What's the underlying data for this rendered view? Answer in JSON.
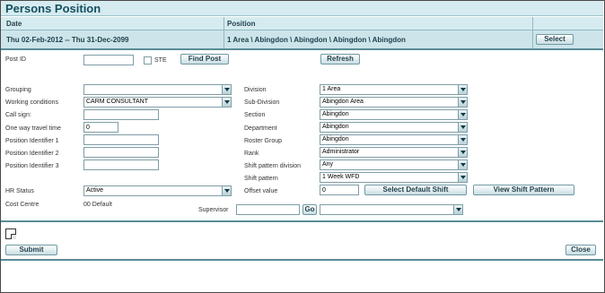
{
  "title": "Persons Position",
  "header": {
    "date_col": "Date",
    "position_col": "Position",
    "date_value": "Thu 02-Feb-2012 -- Thu 31-Dec-2099",
    "position_value": "1 Area \\ Abingdon \\ Abingdon \\ Abingdon \\ Abingdon",
    "select_label": "Select"
  },
  "post": {
    "post_id_label": "Post ID",
    "post_id_value": "",
    "ste_label": "STE",
    "find_post_label": "Find Post",
    "refresh_label": "Refresh"
  },
  "left": {
    "grouping_label": "Grouping",
    "grouping_value": "",
    "working_conditions_label": "Working conditions",
    "working_conditions_value": "CARM CONSULTANT",
    "call_sign_label": "Call sign:",
    "call_sign_value": "",
    "travel_label": "One way travel time",
    "travel_value": "0",
    "pos_id1_label": "Position Identifier 1",
    "pos_id2_label": "Position Identifier 2",
    "pos_id3_label": "Position Identifier 3",
    "hr_status_label": "HR Status",
    "hr_status_value": "Active",
    "cost_centre_label": "Cost Centre",
    "cost_centre_value": "00 Default"
  },
  "right": {
    "division_label": "Division",
    "division_value": "1 Area",
    "subdivision_label": "Sub-Division",
    "subdivision_value": "Abingdon Area",
    "section_label": "Section",
    "section_value": "Abingdon",
    "department_label": "Department",
    "department_value": "Abingdon",
    "roster_label": "Roster Group",
    "roster_value": "Abingdon",
    "rank_label": "Rank",
    "rank_value": "Administrator",
    "spd_label": "Shift pattern division",
    "spd_value": "Any",
    "sp_label": "Shift pattern",
    "sp_value": "1 Week WFD",
    "offset_label": "Offset value",
    "offset_value": "0",
    "select_default_shift_label": "Select Default Shift",
    "view_shift_pattern_label": "View Shift Pattern",
    "supervisor_label": "Supervisor",
    "supervisor_value": "",
    "go_label": "Go",
    "supervisor_select_value": ""
  },
  "footer": {
    "submit_label": "Submit",
    "close_label": "Close"
  },
  "icons": {
    "doc_icon": "document-icon"
  }
}
